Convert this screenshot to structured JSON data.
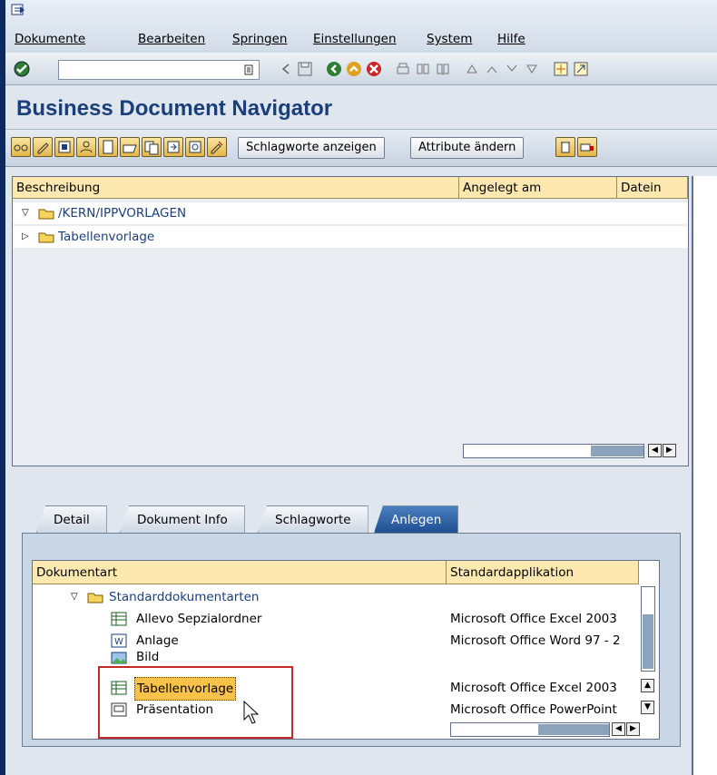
{
  "menu": {
    "items": [
      "Dokumente",
      "Bearbeiten",
      "Springen",
      "Einstellungen",
      "System",
      "Hilfe"
    ]
  },
  "toolbar": {
    "command_field": ""
  },
  "app": {
    "title": "Business Document Navigator"
  },
  "app_toolbar": {
    "schlagworte_label": "Schlagworte anzeigen",
    "attribute_label": "Attribute ändern"
  },
  "tree": {
    "columns": [
      "Beschreibung",
      "Angelegt am",
      "Datein"
    ],
    "root": "/KERN/IPPVORLAGEN",
    "child": "Tabellenvorlage"
  },
  "tabs": [
    "Detail",
    "Dokument Info",
    "Schlagworte",
    "Anlegen"
  ],
  "active_tab": "Anlegen",
  "doctable": {
    "columns": [
      "Dokumentart",
      "Standardapplikation"
    ],
    "group": "Standarddokumentarten",
    "rows": [
      {
        "name": "Allevo Sepzialordner",
        "app": "Microsoft Office Excel 2003"
      },
      {
        "name": "Anlage",
        "app": "Microsoft Office Word 97 - 2"
      },
      {
        "name": "Bild",
        "app": ""
      },
      {
        "name": "Tabellenvorlage",
        "app": "Microsoft Office Excel 2003"
      },
      {
        "name": "Präsentation",
        "app": "Microsoft Office PowerPoint"
      }
    ]
  },
  "colors": {
    "accent": "#1b3f7a",
    "header_bg": "#fde9b0",
    "selection": "#fbc24a",
    "highlight_box": "#c32a2a"
  }
}
